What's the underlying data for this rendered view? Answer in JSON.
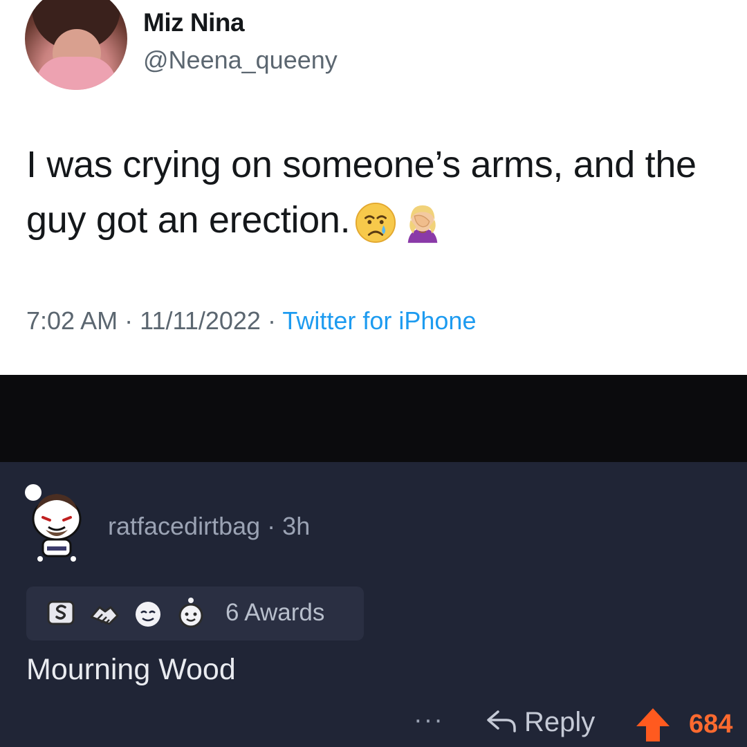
{
  "tweet": {
    "display_name": "Miz Nina",
    "handle": "@Neena_queeny",
    "text": "I was crying on someone’s arms, and the guy got an erection.",
    "emojis": [
      "crying-face-emoji",
      "woman-facepalming-emoji"
    ],
    "time": "7:02 AM",
    "separator": "·",
    "date": "11/11/2022",
    "source": "Twitter for iPhone",
    "colors": {
      "source_link": "#1d9bf0",
      "meta_text": "#5b6670",
      "body_text": "#14171a"
    }
  },
  "comment": {
    "username": "ratfacedirtbag",
    "separator": "·",
    "age": "3h",
    "awards_label": "6 Awards",
    "award_icons": [
      "silver-award-icon",
      "handshake-award-icon",
      "wholesome-award-icon",
      "helpful-award-icon"
    ],
    "body": "Mourning Wood",
    "more_label": "···",
    "reply_label": "Reply",
    "score": "684",
    "colors": {
      "background": "#202536",
      "upvote": "#ff6a2f",
      "meta_text": "#9ba3b4"
    }
  }
}
